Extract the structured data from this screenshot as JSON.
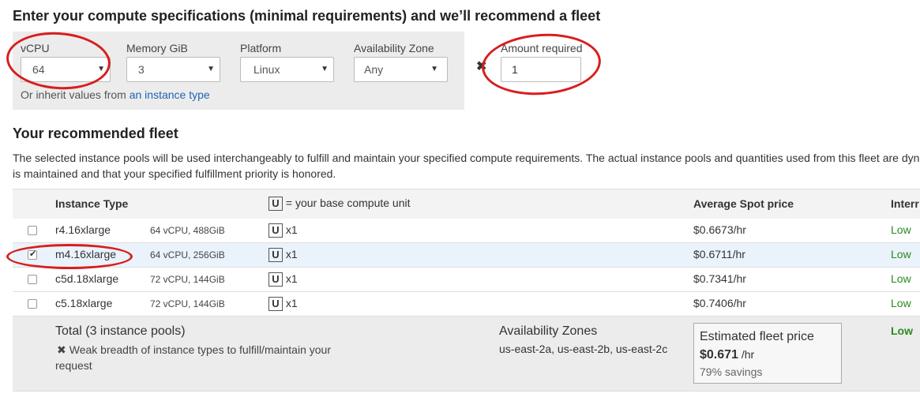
{
  "header": {
    "title": "Enter your compute specifications (minimal requirements) and we’ll recommend a fleet"
  },
  "specs": {
    "vcpu": {
      "label": "vCPU",
      "value": "64"
    },
    "memory": {
      "label": "Memory GiB",
      "value": "3"
    },
    "platform": {
      "label": "Platform",
      "value": "Linux"
    },
    "az": {
      "label": "Availability Zone",
      "value": "Any"
    },
    "inherit_text": "Or inherit values from ",
    "inherit_link": "an instance type",
    "amount": {
      "label": "Amount required",
      "value": "1"
    }
  },
  "fleet": {
    "title": "Your recommended fleet",
    "desc_line1": "The selected instance pools will be used interchangeably to fulfill and maintain your specified compute requirements. The actual instance pools and quantities used from this fleet are dyn",
    "desc_line2": "is maintained and that your specified fulfillment priority is honored."
  },
  "table": {
    "headers": {
      "instance_type": "Instance Type",
      "unit_box": "U",
      "unit_desc": "= your base compute unit",
      "price": "Average Spot price",
      "interruption": "Interr"
    },
    "rows": [
      {
        "name": "r4.16xlarge",
        "spec": "64 vCPU, 488GiB",
        "unit": "U",
        "qty": "x1",
        "price": "$0.6673/hr",
        "interruption": "Low",
        "checked": false
      },
      {
        "name": "m4.16xlarge",
        "spec": "64 vCPU, 256GiB",
        "unit": "U",
        "qty": "x1",
        "price": "$0.6711/hr",
        "interruption": "Low",
        "checked": true
      },
      {
        "name": "c5d.18xlarge",
        "spec": "72 vCPU, 144GiB",
        "unit": "U",
        "qty": "x1",
        "price": "$0.7341/hr",
        "interruption": "Low",
        "checked": false
      },
      {
        "name": "c5.18xlarge",
        "spec": "72 vCPU, 144GiB",
        "unit": "U",
        "qty": "x1",
        "price": "$0.7406/hr",
        "interruption": "Low",
        "checked": false
      }
    ]
  },
  "total": {
    "title": "Total (3 instance pools)",
    "warning_icon": "✖",
    "warning": "Weak breadth of instance types to fulfill/maintain your request",
    "az_title": "Availability Zones",
    "az_list": "us-east-2a, us-east-2b, us-east-2c",
    "est_title": "Estimated fleet price",
    "est_price": "$0.671",
    "est_unit": " /hr",
    "savings": "79% savings",
    "interruption": "Low"
  },
  "colors": {
    "link": "#1f64b5",
    "low": "#2b8a1e",
    "annotation": "#d81e1e",
    "selected_row": "#eaf3fb"
  }
}
